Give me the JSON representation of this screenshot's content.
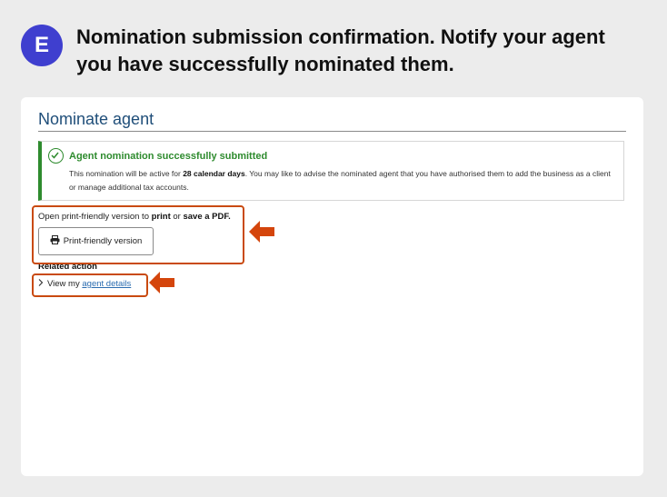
{
  "step": {
    "letter": "E",
    "badge_color": "#3f3fcf"
  },
  "headline": "Nomination submission confirmation. Notify your agent you have successfully nominated them.",
  "page": {
    "heading": "Nominate agent",
    "notice": {
      "title": "Agent nomination successfully submitted",
      "body_prefix": "This nomination will be active for ",
      "body_emphasis": "28 calendar days",
      "body_suffix": ". You may like to advise the nominated agent that you have authorised them to add the business as a client or manage additional tax accounts.",
      "accent_color": "#2e8b2e",
      "icon": "check-circle-icon"
    },
    "print_section": {
      "text_prefix": "Open print-friendly version to ",
      "text_emphasis_1": "print",
      "text_middle": " or ",
      "text_emphasis_2": "save a PDF.",
      "button_label": "Print-friendly version",
      "button_icon": "printer-icon"
    },
    "related": {
      "heading": "Related action",
      "item_prefix": "View my ",
      "item_link": "agent details",
      "item_icon": "chevron-right-icon"
    }
  },
  "annotations": {
    "highlight_color": "#c94a10",
    "arrow_color": "#d4450c"
  }
}
